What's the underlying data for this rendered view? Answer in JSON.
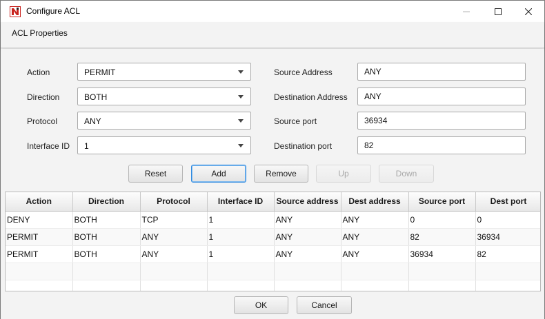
{
  "window": {
    "title": "Configure ACL",
    "icon": "app-logo-icon"
  },
  "menu": {
    "items": [
      "ACL Properties"
    ]
  },
  "form": {
    "action": {
      "label": "Action",
      "value": "PERMIT"
    },
    "direction": {
      "label": "Direction",
      "value": "BOTH"
    },
    "protocol": {
      "label": "Protocol",
      "value": "ANY"
    },
    "interface_id": {
      "label": "Interface ID",
      "value": "1"
    },
    "source_address": {
      "label": "Source Address",
      "value": "ANY"
    },
    "destination_address": {
      "label": "Destination Address",
      "value": "ANY"
    },
    "source_port": {
      "label": "Source port",
      "value": "36934"
    },
    "destination_port": {
      "label": "Destination port",
      "value": "82"
    }
  },
  "buttons": {
    "reset": "Reset",
    "add": "Add",
    "remove": "Remove",
    "up": "Up",
    "down": "Down",
    "ok": "OK",
    "cancel": "Cancel"
  },
  "table": {
    "columns": [
      "Action",
      "Direction",
      "Protocol",
      "Interface ID",
      "Source address",
      "Dest address",
      "Source port",
      "Dest port"
    ],
    "rows": [
      [
        "DENY",
        "BOTH",
        "TCP",
        "1",
        "ANY",
        "ANY",
        "0",
        "0"
      ],
      [
        "PERMIT",
        "BOTH",
        "ANY",
        "1",
        "ANY",
        "ANY",
        "82",
        "36934"
      ],
      [
        "PERMIT",
        "BOTH",
        "ANY",
        "1",
        "ANY",
        "ANY",
        "36934",
        "82"
      ]
    ]
  },
  "colors": {
    "focus": "#2f8ae0",
    "logo": "#c9231e"
  }
}
